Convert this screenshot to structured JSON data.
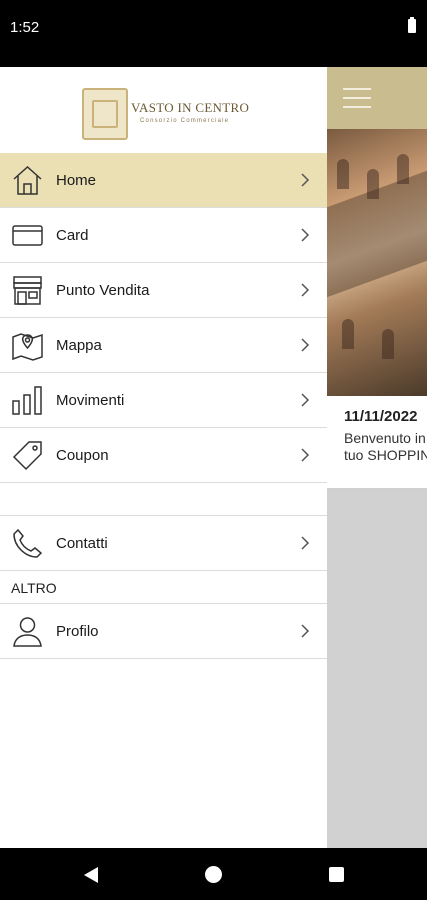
{
  "status_bar": {
    "time": "1:52"
  },
  "brand": {
    "name": "VASTO IN CENTRO",
    "subtitle": "Consorzio Commerciale"
  },
  "drawer": {
    "items": [
      {
        "label": "Home",
        "icon": "home-icon",
        "active": true
      },
      {
        "label": "Card",
        "icon": "card-icon"
      },
      {
        "label": "Punto Vendita",
        "icon": "store-icon"
      },
      {
        "label": "Mappa",
        "icon": "map-icon"
      },
      {
        "label": "Movimenti",
        "icon": "bar-chart-icon"
      },
      {
        "label": "Coupon",
        "icon": "tag-icon"
      }
    ],
    "contact": {
      "label": "Contatti",
      "icon": "phone-icon"
    },
    "section_other": "ALTRO",
    "profile": {
      "label": "Profilo",
      "icon": "user-icon"
    }
  },
  "background": {
    "news_date": "11/11/2022",
    "news_text_line1": "Benvenuto in",
    "news_text_line2": "tuo SHOPPIN"
  },
  "colors": {
    "accent": "#c9bd90",
    "active_row": "#ebdfb4"
  }
}
